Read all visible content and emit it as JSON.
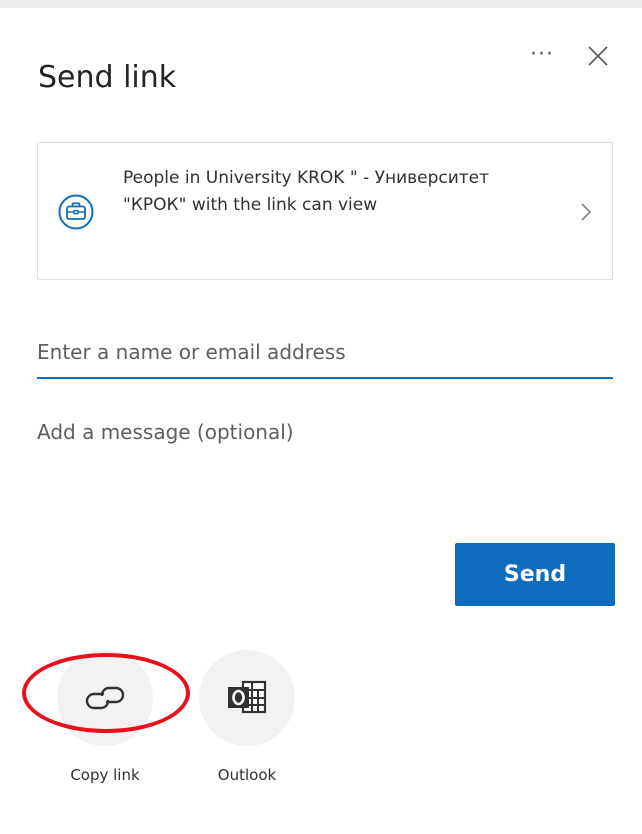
{
  "dialog": {
    "title": "Send link"
  },
  "permission": {
    "text": "People in University KROK \" - Университет \"КРОК\" with the link can view"
  },
  "recipients": {
    "placeholder": "Enter a name or email address",
    "value": ""
  },
  "message": {
    "placeholder": "Add a message (optional)",
    "value": ""
  },
  "actions": {
    "send_label": "Send",
    "more_label": "···"
  },
  "share_targets": [
    {
      "label": "Copy link",
      "icon": "link-icon"
    },
    {
      "label": "Outlook",
      "icon": "outlook-icon"
    }
  ],
  "colors": {
    "accent": "#0f6cbd",
    "highlight": "#e8101c"
  }
}
